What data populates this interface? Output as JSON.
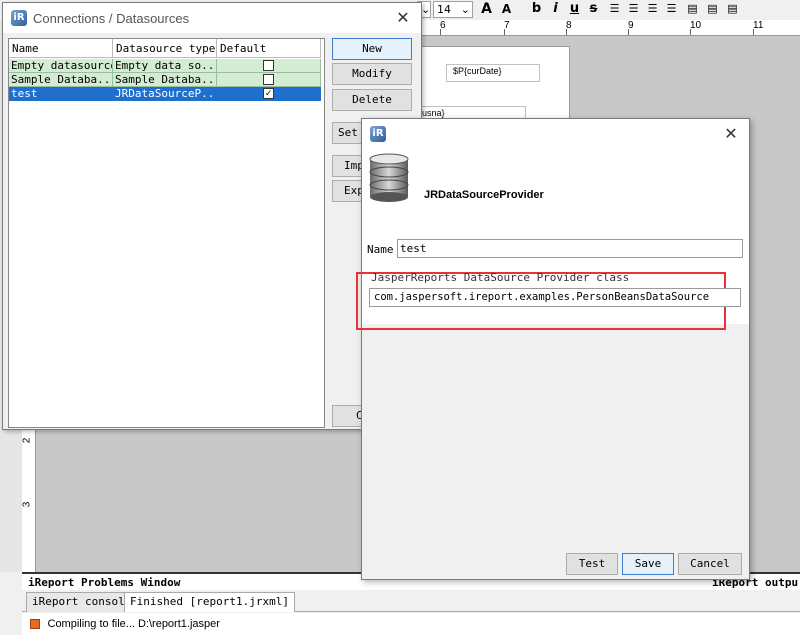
{
  "toolbar": {
    "font_size": "14",
    "buttons": [
      "A",
      "A",
      "b",
      "i",
      "u",
      "s"
    ]
  },
  "ruler": {
    "ticks": [
      "6",
      "7",
      "8",
      "9",
      "10",
      "11"
    ],
    "vertical_ticks": [
      "2",
      "3"
    ]
  },
  "report_page": {
    "field_date": "$P{curDate}",
    "field_usna": "P{usna}"
  },
  "connections_dialog": {
    "title": "Connections / Datasources",
    "columns": [
      "Name",
      "Datasource type",
      "Default"
    ],
    "rows": [
      {
        "name": "Empty datasource",
        "type": "Empty data so...",
        "default": false
      },
      {
        "name": "Sample Databa...",
        "type": "Sample Databa...",
        "default": false
      },
      {
        "name": "test",
        "type": "JRDataSourceP...",
        "default": true
      }
    ],
    "buttons": {
      "new": "New",
      "modify": "Modify",
      "delete": "Delete",
      "set_default": "Set",
      "import": "Imp",
      "export": "Exp",
      "close": "C"
    }
  },
  "jrds_dialog": {
    "header_title": "JRDataSourceProvider",
    "name_label": "Name",
    "name_value": "test",
    "class_label": "JasperReports DataSource Provider class",
    "class_value": "com.jaspersoft.ireport.examples.PersonBeansDataSource",
    "buttons": {
      "test": "Test",
      "save": "Save",
      "cancel": "Cancel"
    }
  },
  "bottom": {
    "problems_title": "iReport Problems Window",
    "output_title": "iReport outpu",
    "tabs": [
      "iReport console",
      "Finished [report1.jrxml]"
    ],
    "console_text": "Compiling to file... D:\\report1.jasper"
  },
  "colors": {
    "selection": "#1f6fcf",
    "row_green": "#d4ecd4",
    "highlight_red": "#e8323a"
  }
}
